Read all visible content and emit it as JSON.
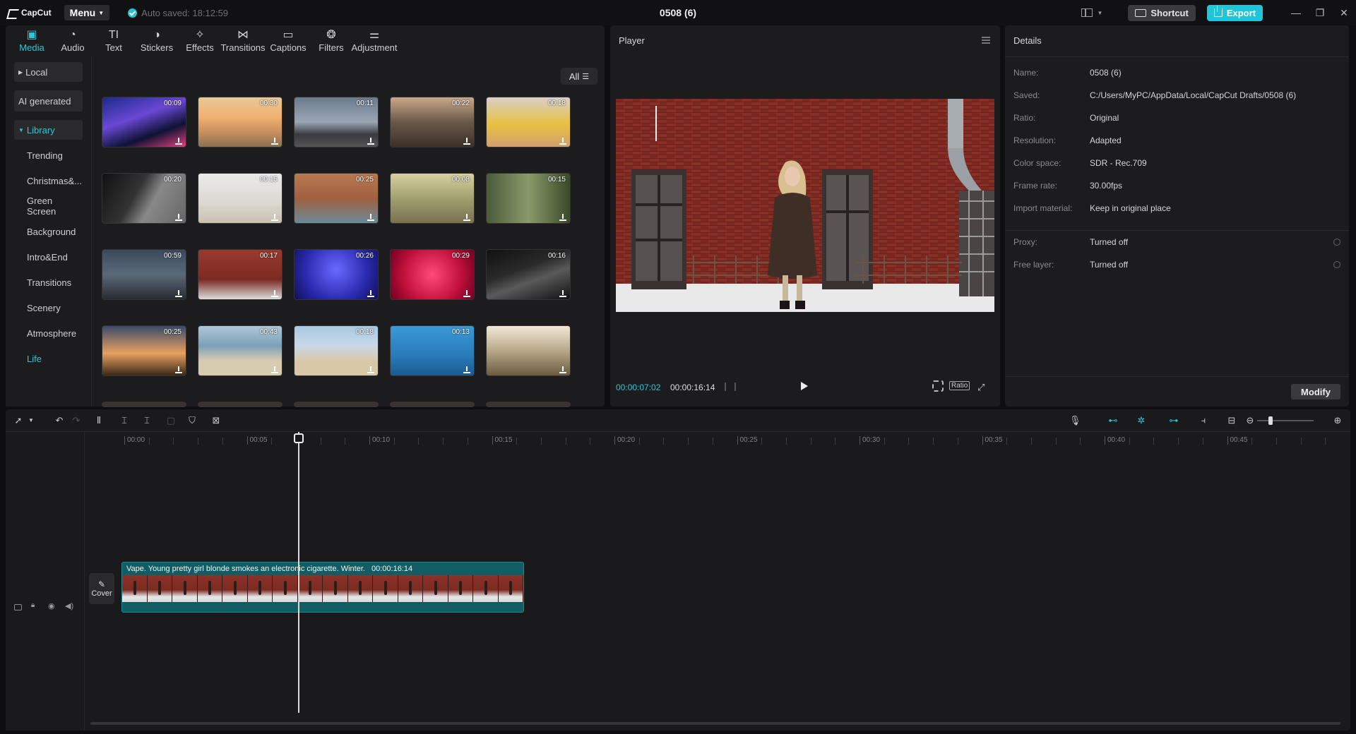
{
  "app": {
    "logo_text": "CapCut",
    "menu_label": "Menu",
    "autosave": "Auto saved: 18:12:59",
    "doc_title": "0508 (6)",
    "shortcut_label": "Shortcut",
    "export_label": "Export",
    "accent_color": "#2bc7d8"
  },
  "media_tabs": [
    {
      "label": "Media",
      "icon": "media-icon",
      "glyph": "▣"
    },
    {
      "label": "Audio",
      "icon": "audio-icon",
      "glyph": "◔"
    },
    {
      "label": "Text",
      "icon": "text-icon",
      "glyph": "TI"
    },
    {
      "label": "Stickers",
      "icon": "sticker-icon",
      "glyph": "◑"
    },
    {
      "label": "Effects",
      "icon": "effects-icon",
      "glyph": "✧"
    },
    {
      "label": "Transitions",
      "icon": "transitions-icon",
      "glyph": "⋈"
    },
    {
      "label": "Captions",
      "icon": "captions-icon",
      "glyph": "▭"
    },
    {
      "label": "Filters",
      "icon": "filters-icon",
      "glyph": "❂"
    },
    {
      "label": "Adjustment",
      "icon": "adjustment-icon",
      "glyph": "⚌"
    }
  ],
  "sidebar": {
    "local": "Local",
    "ai_generated": "AI generated",
    "library": "Library",
    "categories": [
      "Trending",
      "Christmas&...",
      "Green Screen",
      "Background",
      "Intro&End",
      "Transitions",
      "Scenery",
      "Atmosphere",
      "Life"
    ]
  },
  "filter_label": "All",
  "thumbnails": [
    {
      "dur": "00:09",
      "bg": "linear-gradient(160deg,#1b2a8a,#6a48d4 40%,#0e1234 70%,#e04080)"
    },
    {
      "dur": "00:30",
      "bg": "linear-gradient(180deg,#e8c898,#f0b070 40%,#c89060 70%,#8a7050)"
    },
    {
      "dur": "00:11",
      "bg": "linear-gradient(180deg,#6a7a8e,#9aa6b4 50%,#3a3a40 75%,#555)"
    },
    {
      "dur": "00:22",
      "bg": "linear-gradient(180deg,#c8a88a,#6a5848 50%,#3a3028)"
    },
    {
      "dur": "00:18",
      "bg": "linear-gradient(180deg,#d8d0c8,#e8c040 55%,#d0a070)"
    },
    {
      "dur": "00:20",
      "bg": "linear-gradient(120deg,#111,#333 40%,#888 60%,#666)"
    },
    {
      "dur": "00:15",
      "bg": "linear-gradient(180deg,#eaeaea,#dcd8d0 60%,#c8c0b0)"
    },
    {
      "dur": "00:25",
      "bg": "linear-gradient(180deg,#b87a50,#a06040 50%,#6a8a9a)"
    },
    {
      "dur": "00:08",
      "bg": "linear-gradient(180deg,#d8d0a0,#a0a070 50%,#7a7050)"
    },
    {
      "dur": "00:15",
      "bg": "linear-gradient(90deg,#4a5a3a,#8a9a6a 50%,#3a4a2a)"
    },
    {
      "dur": "00:59",
      "bg": "linear-gradient(180deg,#3a4a5a,#5a6a7a 50%,#2a2a30)"
    },
    {
      "dur": "00:17",
      "bg": "linear-gradient(180deg,#9a3a2e,#7a2a22 60%,#dcdcdc)"
    },
    {
      "dur": "00:26",
      "bg": "radial-gradient(circle at 50% 40%,#6a6aff,#2a2ab0 60%,#10105a)"
    },
    {
      "dur": "00:29",
      "bg": "radial-gradient(circle at 50% 50%,#ff4a7a,#c0103a 60%,#700020)"
    },
    {
      "dur": "00:16",
      "bg": "linear-gradient(160deg,#111,#2a2a2a 40%,#5a5a5a 60%,#111)"
    },
    {
      "dur": "00:25",
      "bg": "linear-gradient(180deg,#3a4a6a,#e8a060 55%,#3a2818)"
    },
    {
      "dur": "00:43",
      "bg": "linear-gradient(180deg,#b0c8d8,#7aa0b8 40%,#d8ccb0 70%)"
    },
    {
      "dur": "00:18",
      "bg": "linear-gradient(180deg,#a8c8e0,#c8d8e8 40%,#d8c8a8 70%)"
    },
    {
      "dur": "00:13",
      "bg": "linear-gradient(180deg,#3a9ad8,#2a7ab8 60%,#1a5a90)"
    },
    {
      "dur": "",
      "bg": "linear-gradient(180deg,#f0e8d8,#b8a888 50%,#6a5a40)"
    }
  ],
  "player": {
    "title": "Player",
    "current_time": "00:00:07:02",
    "duration": "00:00:16:14",
    "ratio_label": "Ratio"
  },
  "details": {
    "title": "Details",
    "rows": [
      {
        "label": "Name:",
        "value": "0508 (6)"
      },
      {
        "label": "Saved:",
        "value": "C:/Users/MyPC/AppData/Local/CapCut Drafts/0508 (6)"
      },
      {
        "label": "Ratio:",
        "value": "Original"
      },
      {
        "label": "Resolution:",
        "value": "Adapted"
      },
      {
        "label": "Color space:",
        "value": "SDR - Rec.709"
      },
      {
        "label": "Frame rate:",
        "value": "30.00fps"
      },
      {
        "label": "Import material:",
        "value": "Keep in original place"
      }
    ],
    "proxy_label": "Proxy:",
    "proxy_value": "Turned off",
    "free_layer_label": "Free layer:",
    "free_layer_value": "Turned off",
    "modify_label": "Modify"
  },
  "timeline": {
    "ruler": [
      "00:00",
      "00:05",
      "00:10",
      "00:15",
      "00:20",
      "00:25",
      "00:30",
      "00:35",
      "00:40",
      "00:45"
    ],
    "cover_label": "Cover",
    "clip_title": "Vape. Young pretty girl blonde smokes an electronic cigarette. Winter.",
    "clip_duration": "00:00:16:14"
  }
}
